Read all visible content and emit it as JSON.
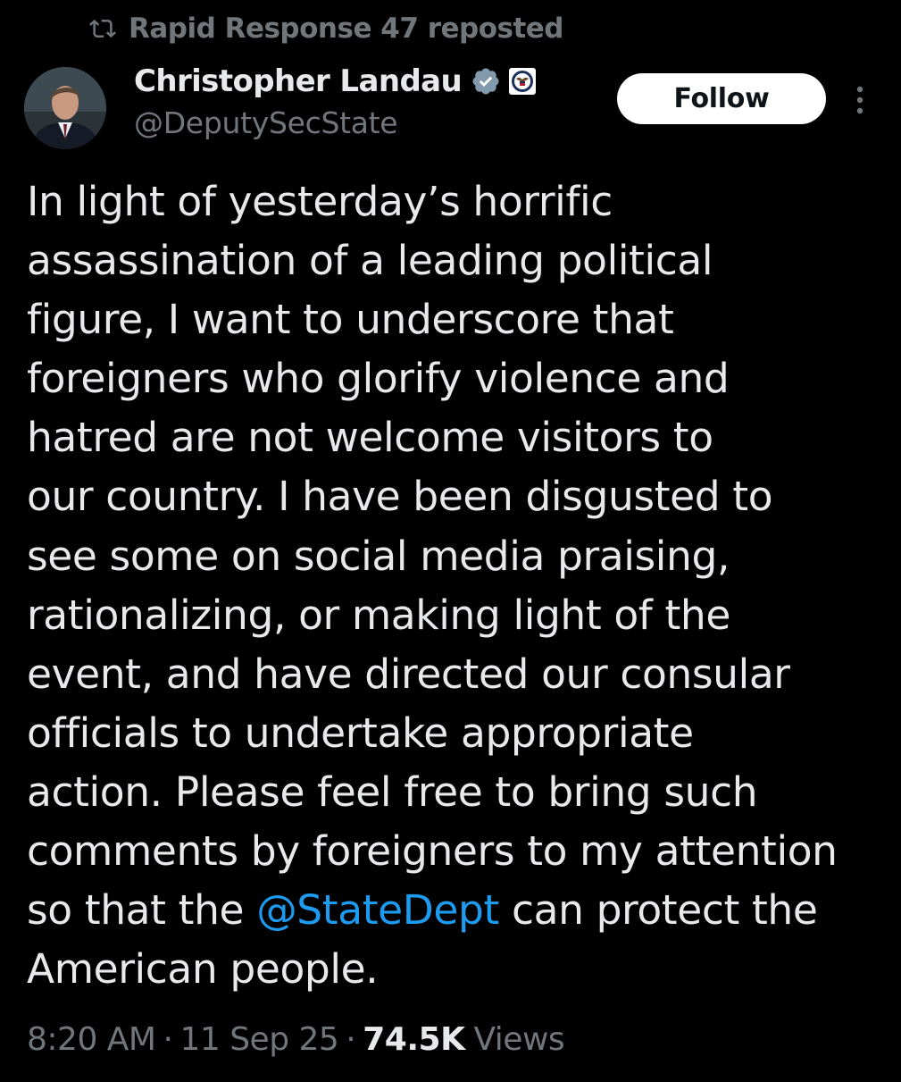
{
  "repost": {
    "icon": "repost-icon",
    "text": "Rapid Response 47 reposted"
  },
  "author": {
    "display_name": "Christopher Landau",
    "handle": "@DeputySecState",
    "verified_icon": "verified-badge-icon",
    "affiliation_icon": "state-department-seal-icon"
  },
  "actions": {
    "follow_label": "Follow",
    "more_icon": "more-options-icon"
  },
  "tweet": {
    "lines": [
      "In light of yesterday’s horrific",
      "assassination of a leading political",
      "figure, I want to underscore that",
      "foreigners who glorify violence and",
      "hatred are not welcome visitors to",
      "our country. I have been disgusted to",
      "see some on social media praising,",
      "rationalizing, or making light of the",
      "event, and have directed our consular",
      "officials to undertake appropriate",
      "action. Please feel free to bring such",
      "comments by foreigners to my attention"
    ],
    "line13_before": "so that the ",
    "mention": "@StateDept",
    "line13_after": " can protect the",
    "line14": "American people."
  },
  "meta": {
    "time": "8:20 AM",
    "separator": "·",
    "date": "11 Sep 25",
    "views_count": "74.5K",
    "views_label": "Views"
  },
  "colors": {
    "background": "#000000",
    "text_primary": "#e7e9ea",
    "text_secondary": "#71767b",
    "link": "#1d9bf0",
    "verified_badge": "#829aab",
    "follow_button_bg": "#ffffff",
    "follow_button_text": "#0f1419"
  }
}
